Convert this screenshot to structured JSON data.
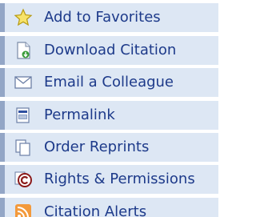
{
  "menu": {
    "items": [
      {
        "label": "Add to Favorites",
        "icon": "star-icon"
      },
      {
        "label": "Download Citation",
        "icon": "download-citation-icon"
      },
      {
        "label": "Email a Colleague",
        "icon": "envelope-icon"
      },
      {
        "label": "Permalink",
        "icon": "permalink-icon"
      },
      {
        "label": "Order Reprints",
        "icon": "reprints-icon"
      },
      {
        "label": "Rights & Permissions",
        "icon": "copyright-icon"
      },
      {
        "label": "Citation Alerts",
        "icon": "rss-alert-icon"
      }
    ]
  },
  "colors": {
    "item_background": "#dde7f4",
    "item_left_border": "#93a6c6",
    "label_text": "#1d3a8a"
  }
}
